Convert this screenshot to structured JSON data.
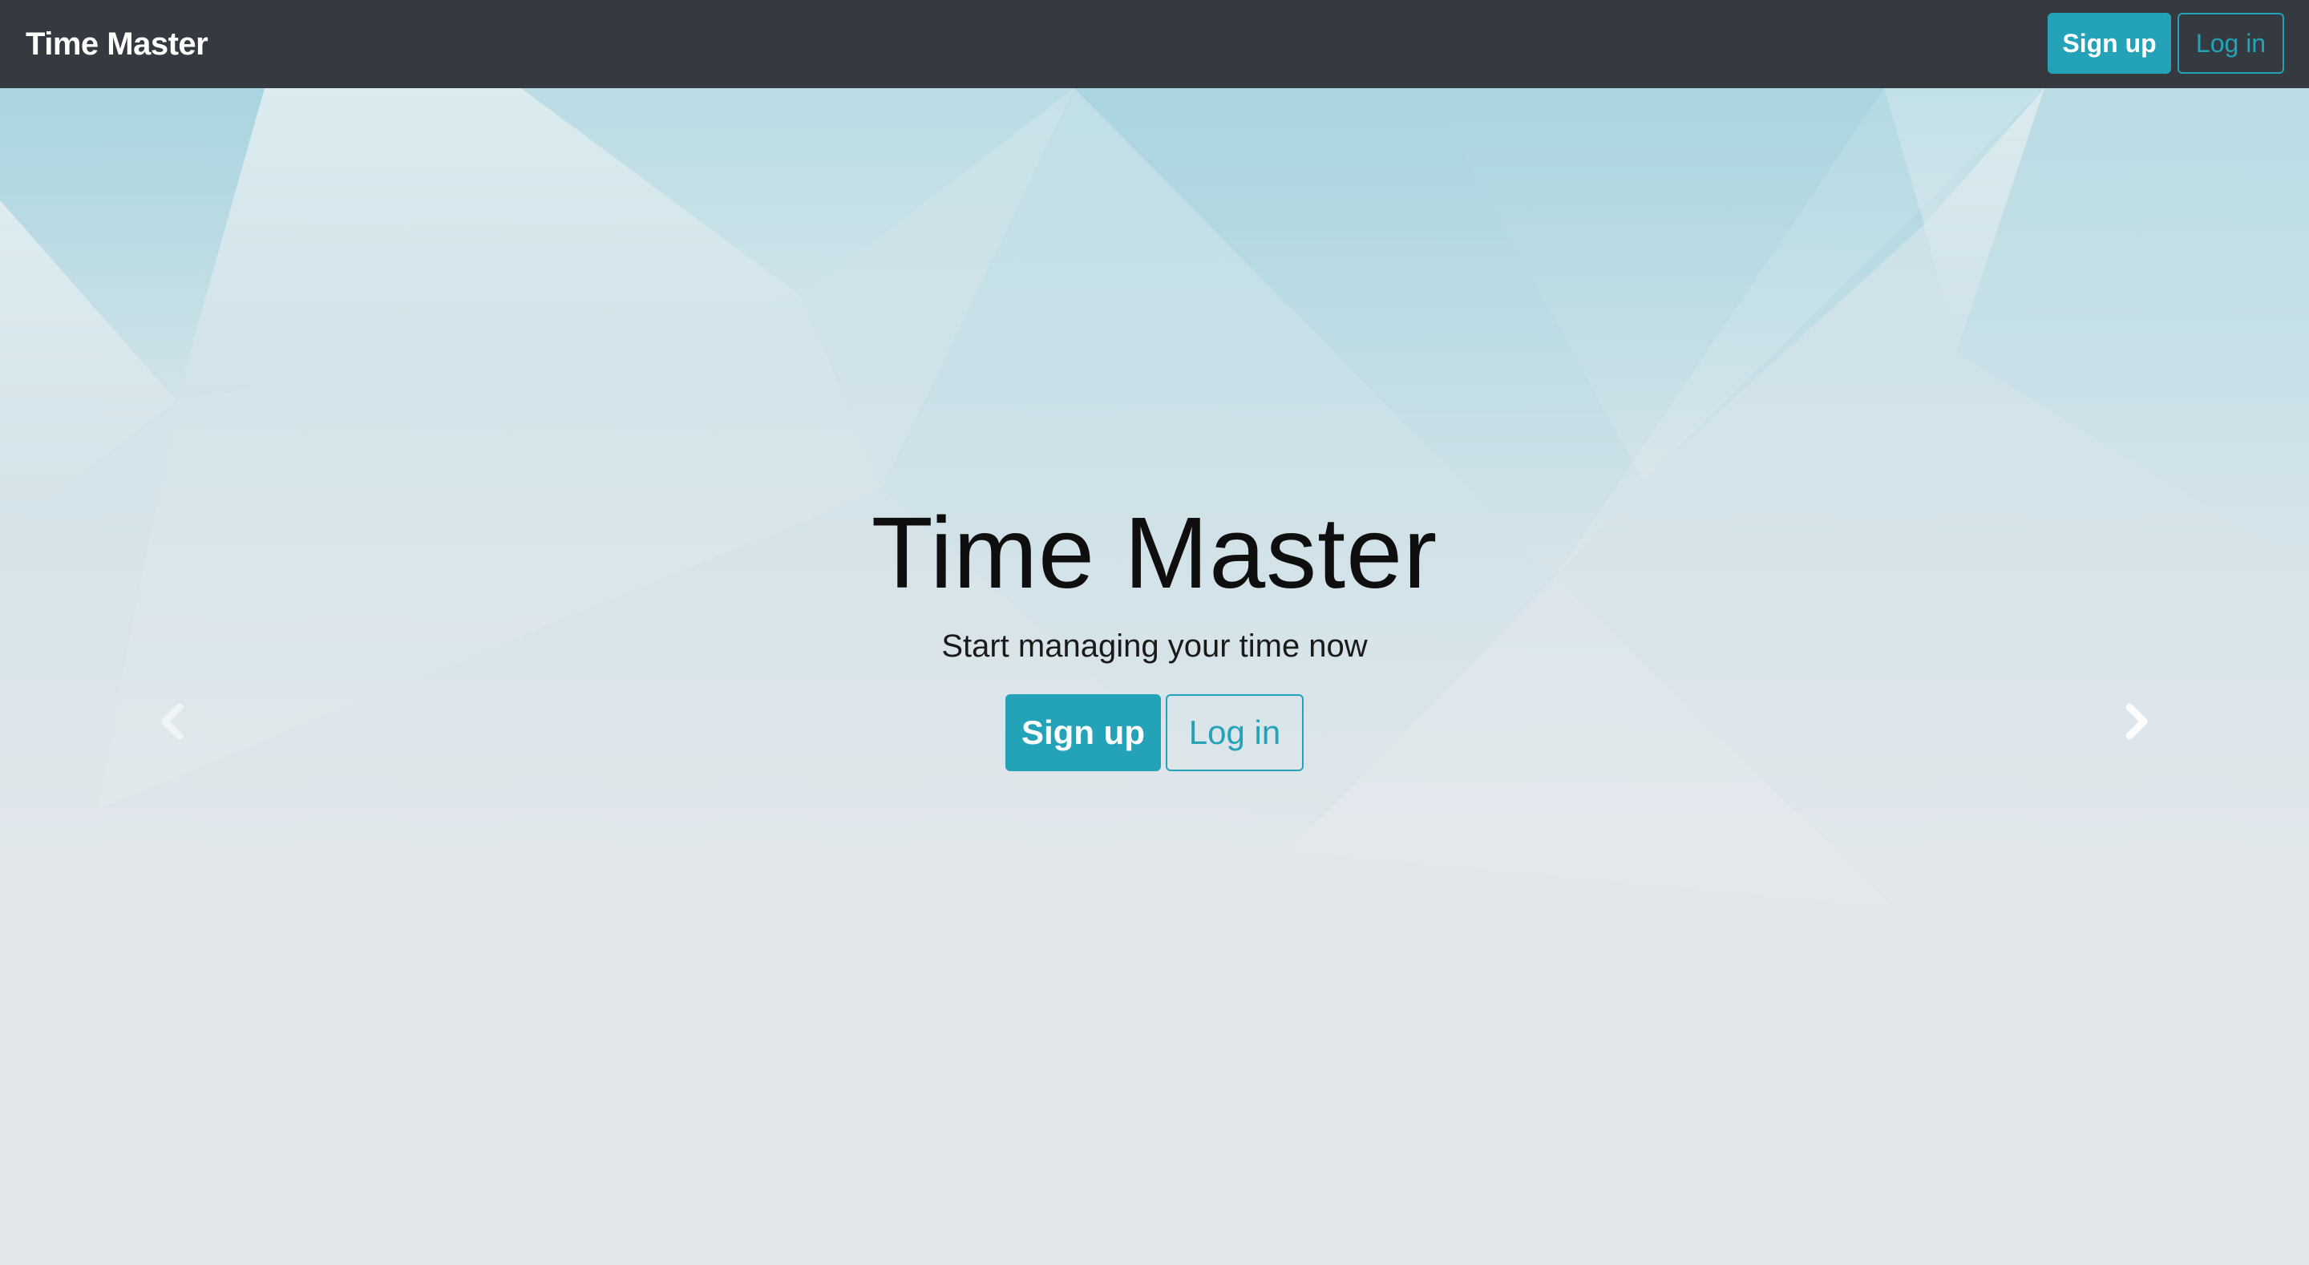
{
  "navbar": {
    "brand": "Time Master",
    "signup_label": "Sign up",
    "login_label": "Log in"
  },
  "hero": {
    "title": "Time Master",
    "subtitle": "Start managing your time now",
    "signup_label": "Sign up",
    "login_label": "Log in"
  },
  "carousel": {
    "prev_icon": "chevron-left-icon",
    "next_icon": "chevron-right-icon"
  },
  "colors": {
    "navbar_bg": "#343a40",
    "accent": "#23a2b8",
    "page_bg": "#e1e6ea"
  }
}
